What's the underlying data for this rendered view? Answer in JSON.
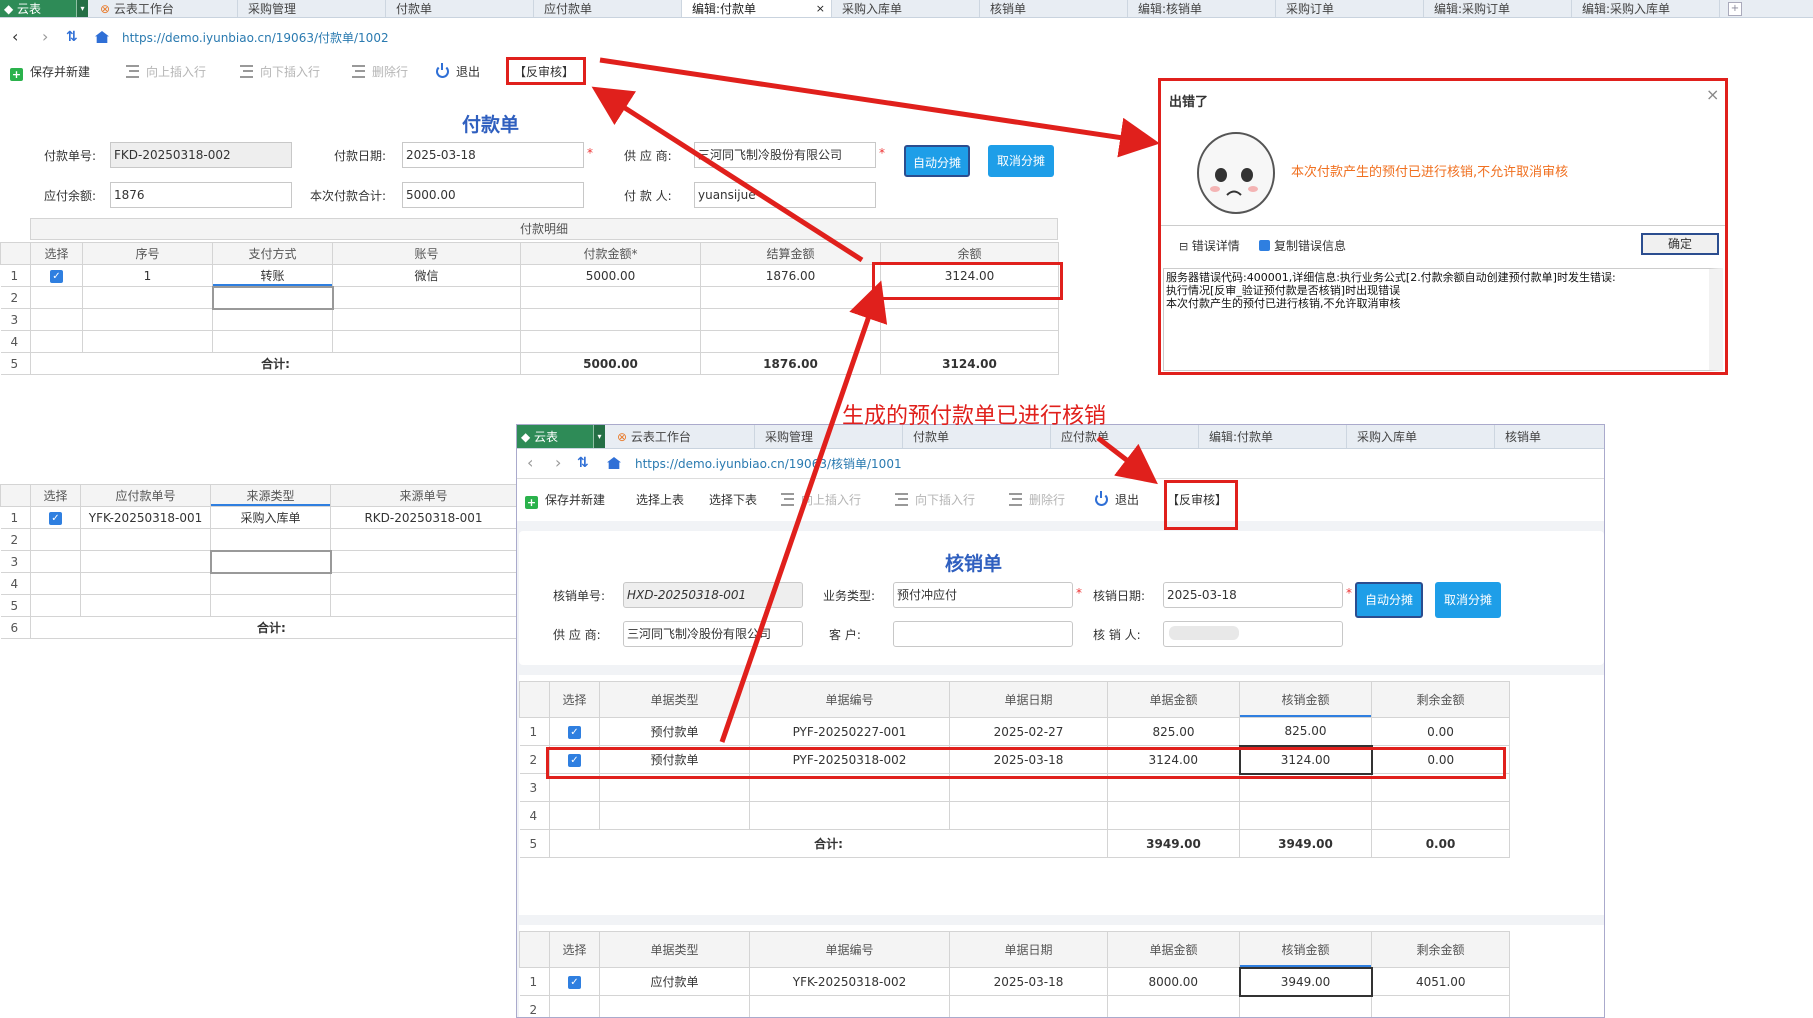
{
  "tabs": {
    "logo": "云表",
    "items": [
      "云表工作台",
      "采购管理",
      "付款单",
      "应付款单",
      "编辑:付款单",
      "采购入库单",
      "核销单",
      "编辑:核销单",
      "采购订单",
      "编辑:采购订单",
      "编辑:采购入库单"
    ],
    "close": "×",
    "add": "+"
  },
  "address": "https://demo.iyunbiao.cn/19063/付款单/1002",
  "toolbar": {
    "save_new": "保存并新建",
    "insert_up": "向上插入行",
    "insert_down": "向下插入行",
    "delete_row": "删除行",
    "exit": "退出",
    "unaudit": "【反审核】"
  },
  "form": {
    "title": "付款单",
    "fields": {
      "no_label": "付款单号:",
      "no": "FKD-20250318-002",
      "date_label": "付款日期:",
      "date": "2025-03-18",
      "supplier_label": "供 应 商:",
      "supplier": "三河同飞制冷股份有限公司",
      "balance_label": "应付余额:",
      "balance": "1876",
      "total_label": "本次付款合计:",
      "total": "5000.00",
      "payer_label": "付 款 人:",
      "payer": "yuansijue"
    },
    "star": "*",
    "auto_btn": "自动分摊",
    "cancel_btn": "取消分摊"
  },
  "detail": {
    "caption": "付款明细",
    "headers": [
      "选择",
      "序号",
      "支付方式",
      "账号",
      "付款金额*",
      "结算金额",
      "余额"
    ],
    "rows": [
      [
        "1",
        "1",
        "转账",
        "微信",
        "5000.00",
        "1876.00",
        "3124.00"
      ]
    ],
    "row_nums": [
      "1",
      "2",
      "3",
      "4",
      "5"
    ],
    "total_label": "合计:",
    "totals": [
      "5000.00",
      "1876.00",
      "3124.00"
    ]
  },
  "source": {
    "headers": [
      "选择",
      "应付款单号",
      "来源类型",
      "来源单号"
    ],
    "rows": [
      [
        "YFK-20250318-001",
        "采购入库单",
        "RKD-20250318-001"
      ]
    ],
    "row_nums": [
      "1",
      "2",
      "3",
      "4",
      "5",
      "6"
    ],
    "total_label": "合计:"
  },
  "error": {
    "title": "出错了",
    "message": "本次付款产生的预付已进行核销,不允许取消审核",
    "detail_link": "错误详情",
    "copy_link": "复制错误信息",
    "ok": "确定",
    "detail_text": "服务器错误代码:400001,详细信息:执行业务公式[2.付款余额自动创建预付款单]时发生错误:\n执行情况[反审_验证预付款是否核销]时出现错误\n本次付款产生的预付已进行核销,不允许取消审核"
  },
  "annotation": "生成的预付款单已进行核销",
  "win2": {
    "tabs": {
      "logo": "云表",
      "items": [
        "云表工作台",
        "采购管理",
        "付款单",
        "应付款单",
        "编辑:付款单",
        "采购入库单",
        "核销单"
      ]
    },
    "address": "https://demo.iyunbiao.cn/19063/核销单/1001",
    "toolbar": {
      "save_new": "保存并新建",
      "select_up": "选择上表",
      "select_down": "选择下表",
      "insert_up": "向上插入行",
      "insert_down": "向下插入行",
      "delete_row": "删除行",
      "exit": "退出",
      "unaudit": "【反审核】"
    },
    "form": {
      "title": "核销单",
      "no_label": "核销单号:",
      "no": "HXD-20250318-001",
      "type_label": "业务类型:",
      "type": "预付冲应付",
      "date_label": "核销日期:",
      "date": "2025-03-18",
      "supplier_label": "供 应 商:",
      "supplier": "三河同飞制冷股份有限公司",
      "customer_label": "客  户:",
      "customer": "",
      "person_label": "核 销 人:",
      "person": "",
      "auto_btn": "自动分摊",
      "cancel_btn": "取消分摊"
    },
    "grid1": {
      "headers": [
        "选择",
        "单据类型",
        "单据编号",
        "单据日期",
        "单据金额",
        "核销金额",
        "剩余金额"
      ],
      "rows": [
        [
          "预付款单",
          "PYF-20250227-001",
          "2025-02-27",
          "825.00",
          "825.00",
          "0.00"
        ],
        [
          "预付款单",
          "PYF-20250318-002",
          "2025-03-18",
          "3124.00",
          "3124.00",
          "0.00"
        ]
      ],
      "row_nums": [
        "1",
        "2",
        "3",
        "4",
        "5"
      ],
      "total_label": "合计:",
      "totals": [
        "3949.00",
        "3949.00",
        "0.00"
      ]
    },
    "grid2": {
      "headers": [
        "选择",
        "单据类型",
        "单据编号",
        "单据日期",
        "单据金额",
        "核销金额",
        "剩余金额"
      ],
      "rows": [
        [
          "应付款单",
          "YFK-20250318-002",
          "2025-03-18",
          "8000.00",
          "3949.00",
          "4051.00"
        ]
      ],
      "row_nums": [
        "1",
        "2"
      ]
    }
  },
  "colors": {
    "accent": "#1e9ee8",
    "annotation": "#e0201c",
    "title": "#2f5fbf",
    "brand": "#2e8b57"
  }
}
